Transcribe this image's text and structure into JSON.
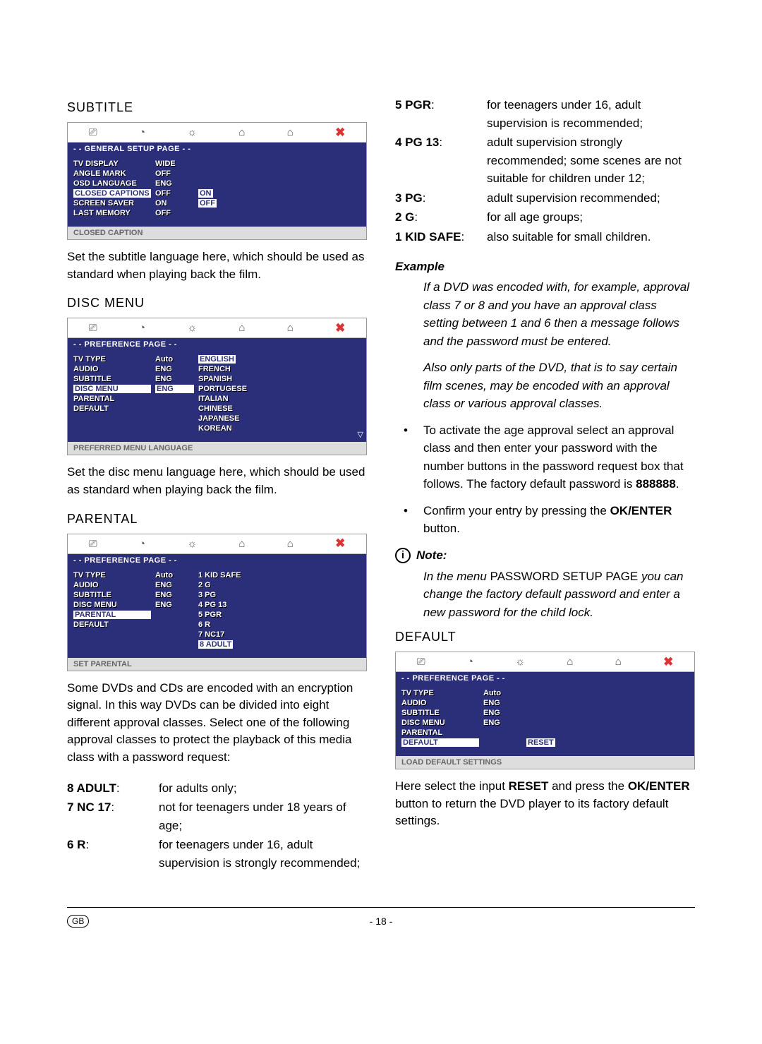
{
  "left": {
    "subtitle_heading": "SUBTITLE",
    "subtitle_panel": {
      "title": "- - GENERAL SETUP PAGE - -",
      "rows": [
        {
          "c1": "TV DISPLAY",
          "c2": "WIDE",
          "c3": ""
        },
        {
          "c1": "ANGLE MARK",
          "c2": "OFF",
          "c3": ""
        },
        {
          "c1": "OSD LANGUAGE",
          "c2": "ENG",
          "c3": ""
        },
        {
          "c1": "CLOSED CAPTIONS",
          "c2": "OFF",
          "c3": "ON",
          "hl_c1": true,
          "hl_c3": true
        },
        {
          "c1": "SCREEN SAVER",
          "c2": "ON",
          "c3": "OFF",
          "hl_c3": true
        },
        {
          "c1": "LAST MEMORY",
          "c2": "OFF",
          "c3": ""
        }
      ],
      "status": "CLOSED CAPTION"
    },
    "subtitle_text": "Set the subtitle language here, which should be used as standard when playing back the film.",
    "discmenu_heading": "DISC MENU",
    "discmenu_panel": {
      "title": "- - PREFERENCE PAGE - -",
      "rows": [
        {
          "c1": "TV TYPE",
          "c2": "Auto",
          "c3": "ENGLISH",
          "hl_c3": true
        },
        {
          "c1": "AUDIO",
          "c2": "ENG",
          "c3": "FRENCH"
        },
        {
          "c1": "SUBTITLE",
          "c2": "ENG",
          "c3": "SPANISH"
        },
        {
          "c1": "DISC MENU",
          "c2": "ENG",
          "c3": "PORTUGESE",
          "hl_c1": true,
          "hl_c2": true
        },
        {
          "c1": "PARENTAL",
          "c2": "",
          "c3": "ITALIAN"
        },
        {
          "c1": "DEFAULT",
          "c2": "",
          "c3": "CHINESE"
        },
        {
          "c1": "",
          "c2": "",
          "c3": "JAPANESE"
        },
        {
          "c1": "",
          "c2": "",
          "c3": "KOREAN"
        }
      ],
      "status": "PREFERRED MENU LANGUAGE",
      "scroll": "▽"
    },
    "discmenu_text": "Set the disc menu language here, which should be used as standard when playing back the film.",
    "parental_heading": "PARENTAL",
    "parental_panel": {
      "title": "- - PREFERENCE PAGE - -",
      "rows": [
        {
          "c1": "TV TYPE",
          "c2": "Auto",
          "c3": "1 KID SAFE"
        },
        {
          "c1": "AUDIO",
          "c2": "ENG",
          "c3": "2 G"
        },
        {
          "c1": "SUBTITLE",
          "c2": "ENG",
          "c3": "3 PG"
        },
        {
          "c1": "DISC MENU",
          "c2": "ENG",
          "c3": "4 PG 13"
        },
        {
          "c1": "PARENTAL",
          "c2": "",
          "c3": "5 PGR",
          "hl_c1": true
        },
        {
          "c1": "DEFAULT",
          "c2": "",
          "c3": "6 R"
        },
        {
          "c1": "",
          "c2": "",
          "c3": "7 NC17"
        },
        {
          "c1": "",
          "c2": "",
          "c3": "8 ADULT",
          "hl_c3": true
        }
      ],
      "status": "SET PARENTAL"
    },
    "parental_text": "Some DVDs and CDs are encoded with an encryption signal. In this way DVDs can be divided into eight different approval classes. Select one of the following approval classes to protect the playback of this media class with a password request:",
    "left_ratings": [
      {
        "key": "8 ADULT",
        "desc": "for adults only;"
      },
      {
        "key": "7 NC 17",
        "desc": "not for teenagers under 18 years of age;"
      },
      {
        "key": "6 R",
        "desc": "for teenagers under 16, adult supervision is strongly recommended;"
      }
    ]
  },
  "right": {
    "right_ratings": [
      {
        "key": "5 PGR",
        "desc": "for teenagers under 16, adult supervision is recommended;"
      },
      {
        "key": "4 PG 13",
        "desc": "adult supervision strongly recommended; some scenes are not suitable for children under 12;"
      },
      {
        "key": "3 PG",
        "desc": "adult supervision recommended;"
      },
      {
        "key": "2 G",
        "desc": "for all age groups;"
      },
      {
        "key": "1 KID SAFE",
        "desc": "also suitable for small children."
      }
    ],
    "example_label": "Example",
    "example_p1": "If a DVD was encoded with, for example, approval class 7 or 8 and you have an approval class setting between 1 and 6 then a message follows and the password must be entered.",
    "example_p2": "Also only parts of the DVD, that is to say certain film scenes, may be encoded with an approval class or various approval classes.",
    "bullet1_pre": "To activate the age approval select an approval class and then enter your password with the number buttons in the password request box that follows. The factory default password is ",
    "bullet1_bold": "888888",
    "bullet1_post": ".",
    "bullet2_pre": "Confirm your entry by pressing the ",
    "bullet2_bold": "OK/ENTER",
    "bullet2_post": " button.",
    "note_label": "Note:",
    "note_p_pre": "In the menu ",
    "note_p_bold": "PASSWORD SETUP PAGE",
    "note_p_post": " you can change the factory default password and enter a new password for the child lock.",
    "default_heading": "DEFAULT",
    "default_panel": {
      "title": "- - PREFERENCE PAGE - -",
      "rows": [
        {
          "c1": "TV TYPE",
          "c2": "Auto",
          "c3": ""
        },
        {
          "c1": "AUDIO",
          "c2": "ENG",
          "c3": ""
        },
        {
          "c1": "SUBTITLE",
          "c2": "ENG",
          "c3": ""
        },
        {
          "c1": "DISC MENU",
          "c2": "ENG",
          "c3": ""
        },
        {
          "c1": "PARENTAL",
          "c2": "",
          "c3": ""
        },
        {
          "c1": "DEFAULT",
          "c2": "",
          "c3": "RESET",
          "hl_c1": true,
          "hl_c3": true
        }
      ],
      "status": "LOAD DEFAULT SETTINGS"
    },
    "default_text_pre": "Here select the input ",
    "default_text_b1": "RESET",
    "default_text_mid": " and press the ",
    "default_text_b2": "OK/ENTER",
    "default_text_post": " button to return the DVD player to its factory default settings."
  },
  "footer": {
    "lang": "GB",
    "page": "- 18 -"
  },
  "icons": {
    "i1": "⎚",
    "i2": "◔",
    "i3": "☼",
    "i4": "⌂",
    "i5": "⌂",
    "i6": "✖"
  }
}
